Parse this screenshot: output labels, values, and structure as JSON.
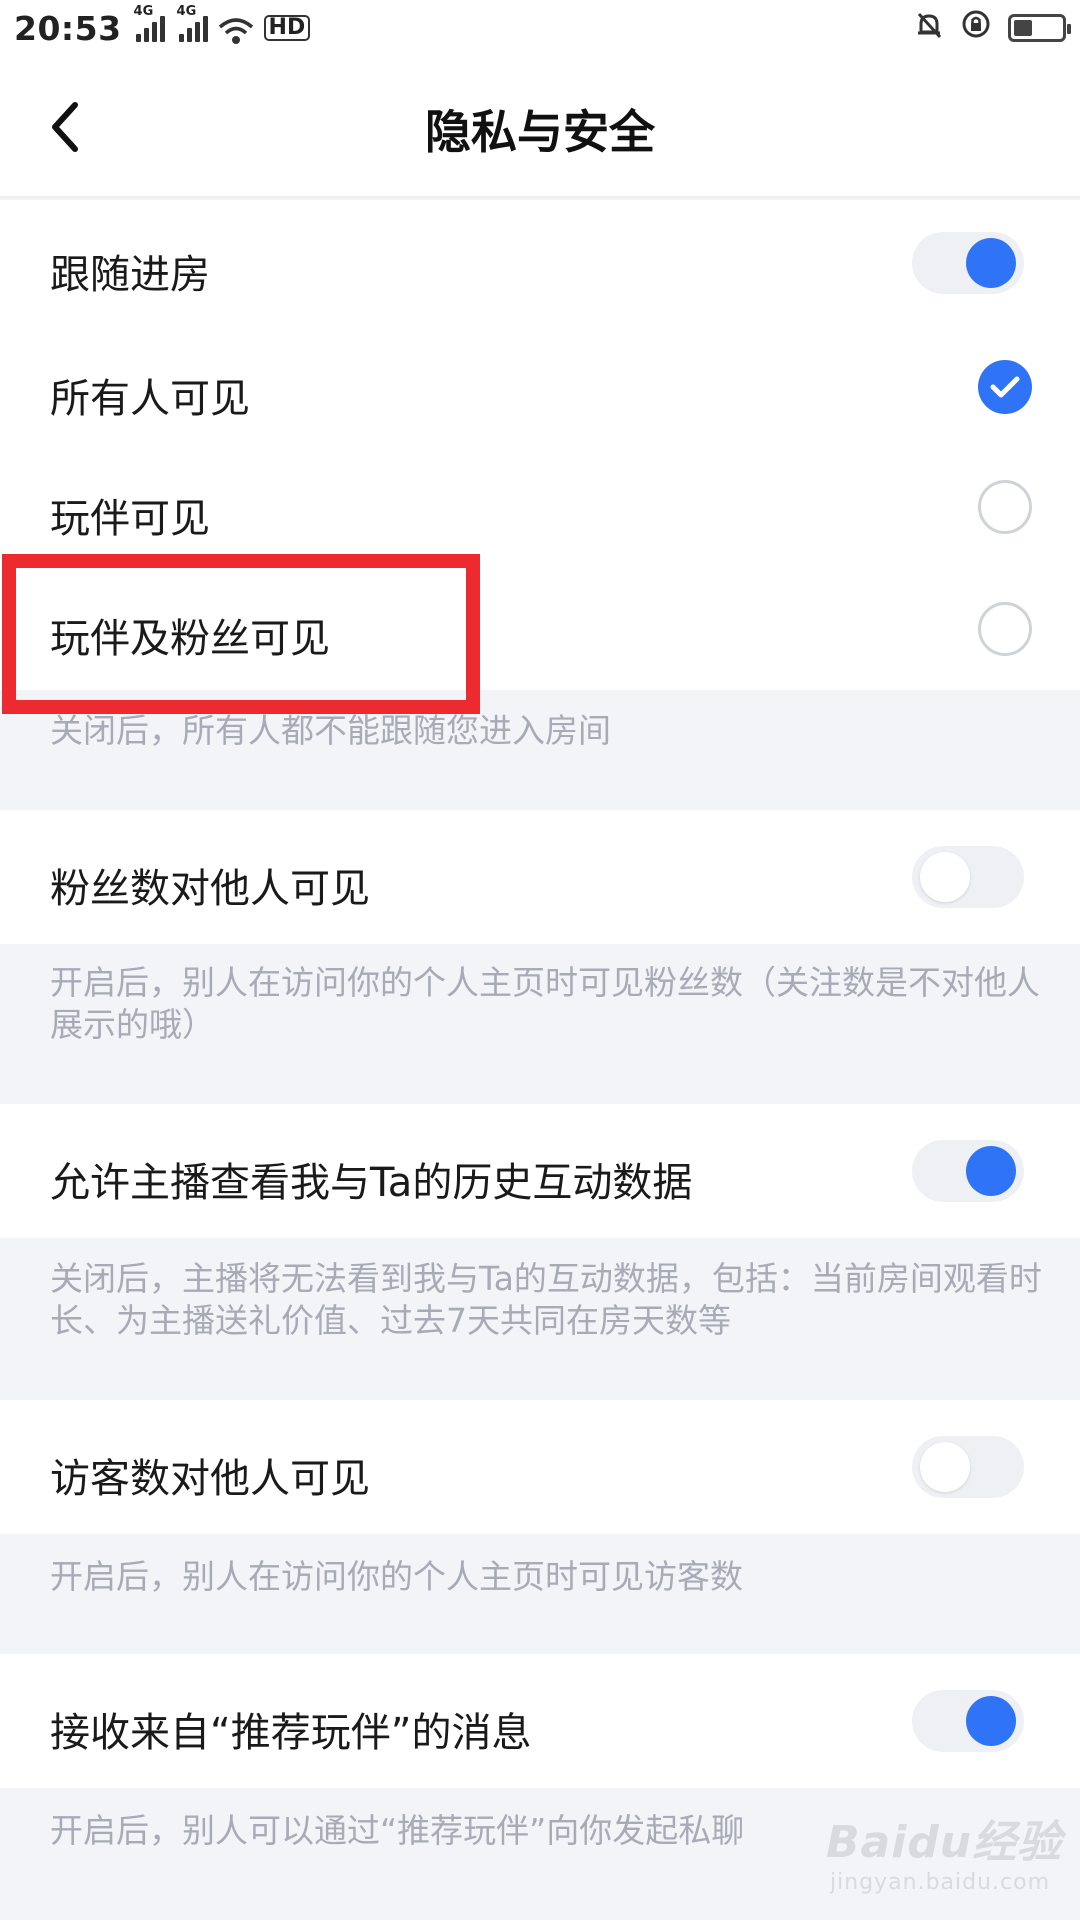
{
  "status_bar": {
    "time": "20:53",
    "signal1_label": "4G",
    "signal2_label": "4G",
    "hd_label": "HD",
    "battery_percent": 40
  },
  "nav": {
    "title": "隐私与安全"
  },
  "follow_room": {
    "label": "跟随进房",
    "enabled": true,
    "options": [
      {
        "label": "所有人可见",
        "selected": true
      },
      {
        "label": "玩伴可见",
        "selected": false
      },
      {
        "label": "玩伴及粉丝可见",
        "selected": false
      }
    ],
    "description": "关闭后，所有人都不能跟随您进入房间"
  },
  "fans_count": {
    "label": "粉丝数对他人可见",
    "enabled": false,
    "description": "开启后，别人在访问你的个人主页时可见粉丝数（关注数是不对他人展示的哦）"
  },
  "interaction_data": {
    "label": "允许主播查看我与Ta的历史互动数据",
    "enabled": true,
    "description": "关闭后，主播将无法看到我与Ta的互动数据，包括：当前房间观看时长、为主播送礼价值、过去7天共同在房天数等"
  },
  "visitor_count": {
    "label": "访客数对他人可见",
    "enabled": false,
    "description": "开启后，别人在访问你的个人主页时可见访客数"
  },
  "recommend_msg": {
    "label": "接收来自“推荐玩伴”的消息",
    "enabled": true,
    "description": "开启后，别人可以通过“推荐玩伴”向你发起私聊"
  },
  "watermark": {
    "brand": "Baidu经验",
    "sub": "jingyan.baidu.com"
  },
  "colors": {
    "accent": "#2f74f6",
    "highlight": "#ec2a2f",
    "desc_text": "#a7abb6",
    "section_bg": "#f3f4f8"
  }
}
